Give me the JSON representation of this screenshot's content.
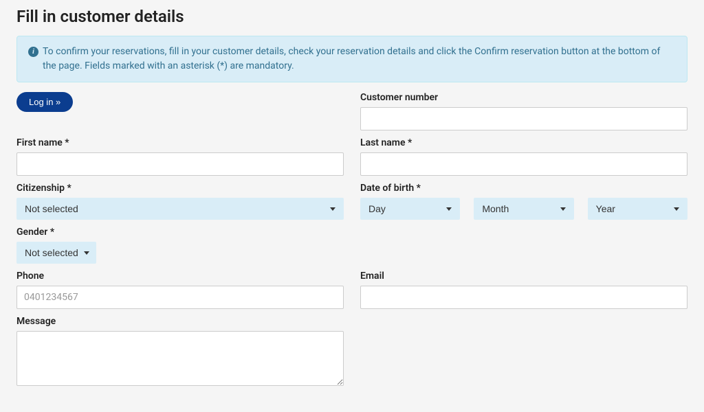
{
  "page": {
    "title": "Fill in customer details"
  },
  "alert": {
    "text": "To confirm your reservations, fill in your customer details, check your reservation details and click the Confirm reservation button at the bottom of the page. Fields marked with an asterisk (*) are mandatory."
  },
  "buttons": {
    "login": "Log in »"
  },
  "labels": {
    "customer_number": "Customer number",
    "first_name": "First name *",
    "last_name": "Last name *",
    "citizenship": "Citizenship *",
    "date_of_birth": "Date of birth *",
    "gender": "Gender *",
    "phone": "Phone",
    "email": "Email",
    "message": "Message"
  },
  "selects": {
    "citizenship": "Not selected",
    "gender": "Not selected",
    "day": "Day",
    "month": "Month",
    "year": "Year"
  },
  "placeholders": {
    "phone": "0401234567"
  }
}
